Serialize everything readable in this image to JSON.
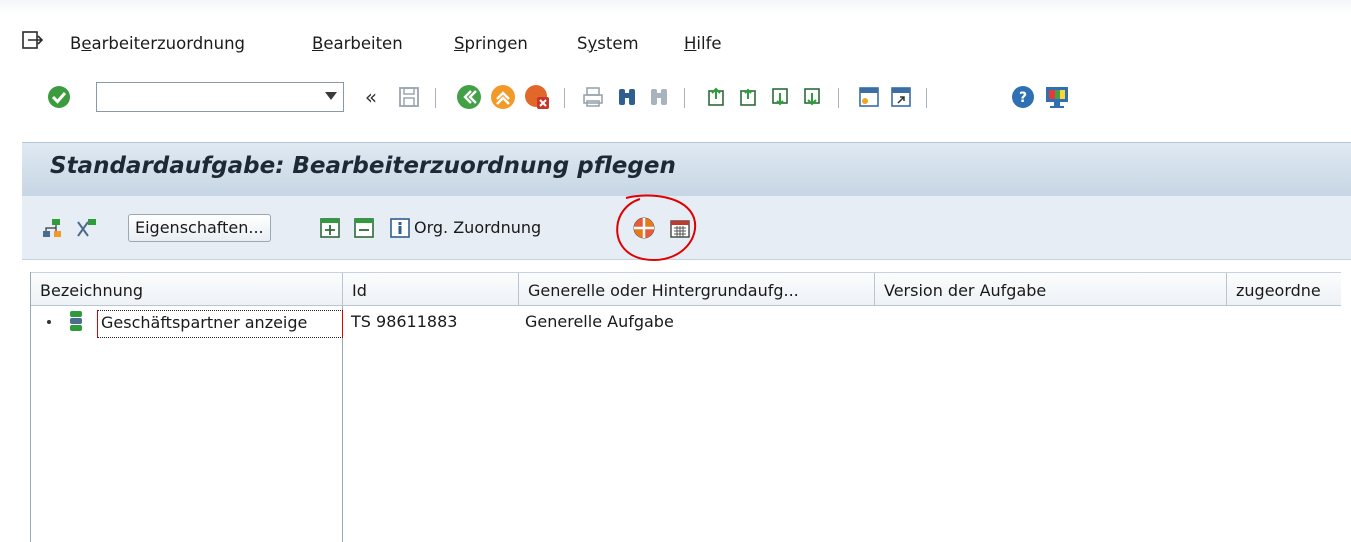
{
  "menubar": {
    "items": [
      {
        "label_pre": "B",
        "label_u": "e",
        "label_post": "arbeiterzuordnung"
      },
      {
        "label_pre": "",
        "label_u": "B",
        "label_post": "earbeiten"
      },
      {
        "label_pre": "",
        "label_u": "S",
        "label_post": "pringen"
      },
      {
        "label_pre": "S",
        "label_u": "y",
        "label_post": "stem"
      },
      {
        "label_pre": "",
        "label_u": "H",
        "label_post": "ilfe"
      }
    ]
  },
  "toolbar": {
    "command_field_value": "",
    "icons": [
      "enter-icon",
      "back-chevrons-icon",
      "save-icon",
      "back-icon",
      "exit-icon",
      "cancel-icon",
      "print-icon",
      "find-icon",
      "find-next-icon",
      "first-page-icon",
      "previous-page-icon",
      "next-page-icon",
      "last-page-icon",
      "new-session-icon",
      "shortcut-icon",
      "help-icon",
      "customize-layout-icon"
    ]
  },
  "title": "Standardaufgabe: Bearbeiterzuordnung pflegen",
  "app_toolbar": {
    "properties_button": "Eigenschaften...",
    "org_assignment_label": "Org. Zuordnung"
  },
  "table": {
    "columns": [
      "Bezeichnung",
      "Id",
      "Generelle oder Hintergrundaufg...",
      "Version der Aufgabe",
      "zugeordne"
    ],
    "rows": [
      {
        "name": "Geschäftspartner anzeige",
        "id": "TS 98611883",
        "type": "Generelle Aufgabe",
        "version": "",
        "assigned": ""
      }
    ]
  },
  "colors": {
    "title_bg": "#c7d6e4",
    "accent_green": "#2e9c3a",
    "accent_orange": "#e8781e",
    "annotation_red": "#e00000"
  }
}
